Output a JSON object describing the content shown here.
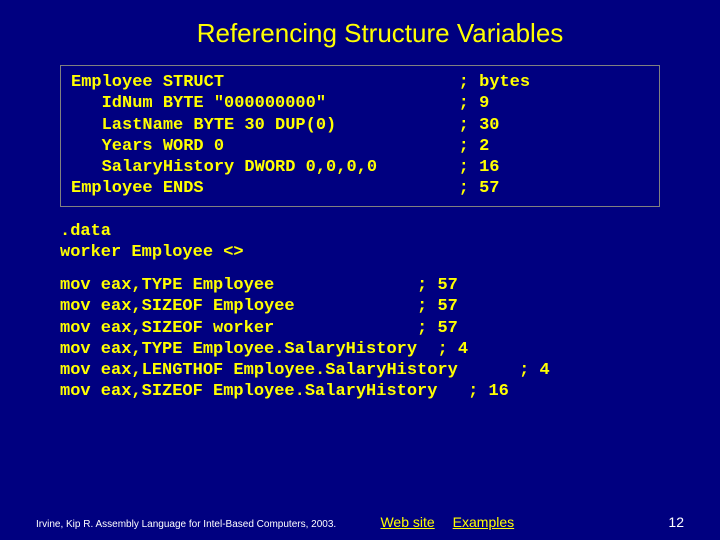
{
  "title": "Referencing Structure Variables",
  "struct_def": {
    "l1": "Employee STRUCT                       ; bytes",
    "l2": "   IdNum BYTE \"000000000\"             ; 9",
    "l3": "   LastName BYTE 30 DUP(0)            ; 30",
    "l4": "   Years WORD 0                       ; 2",
    "l5": "   SalaryHistory DWORD 0,0,0,0        ; 16",
    "l6": "Employee ENDS                         ; 57"
  },
  "data_def": {
    "l1": ".data",
    "l2": "worker Employee <>"
  },
  "ops": {
    "l1": "mov eax,TYPE Employee              ; 57",
    "l2": "mov eax,SIZEOF Employee            ; 57",
    "l3": "mov eax,SIZEOF worker              ; 57",
    "l4": "mov eax,TYPE Employee.SalaryHistory  ; 4",
    "l5": "mov eax,LENGTHOF Employee.SalaryHistory      ; 4",
    "l6": "mov eax,SIZEOF Employee.SalaryHistory   ; 16"
  },
  "footer": {
    "credit": "Irvine, Kip R. Assembly Language for Intel-Based Computers, 2003.",
    "link1": "Web site",
    "link2": "Examples",
    "page": "12"
  }
}
